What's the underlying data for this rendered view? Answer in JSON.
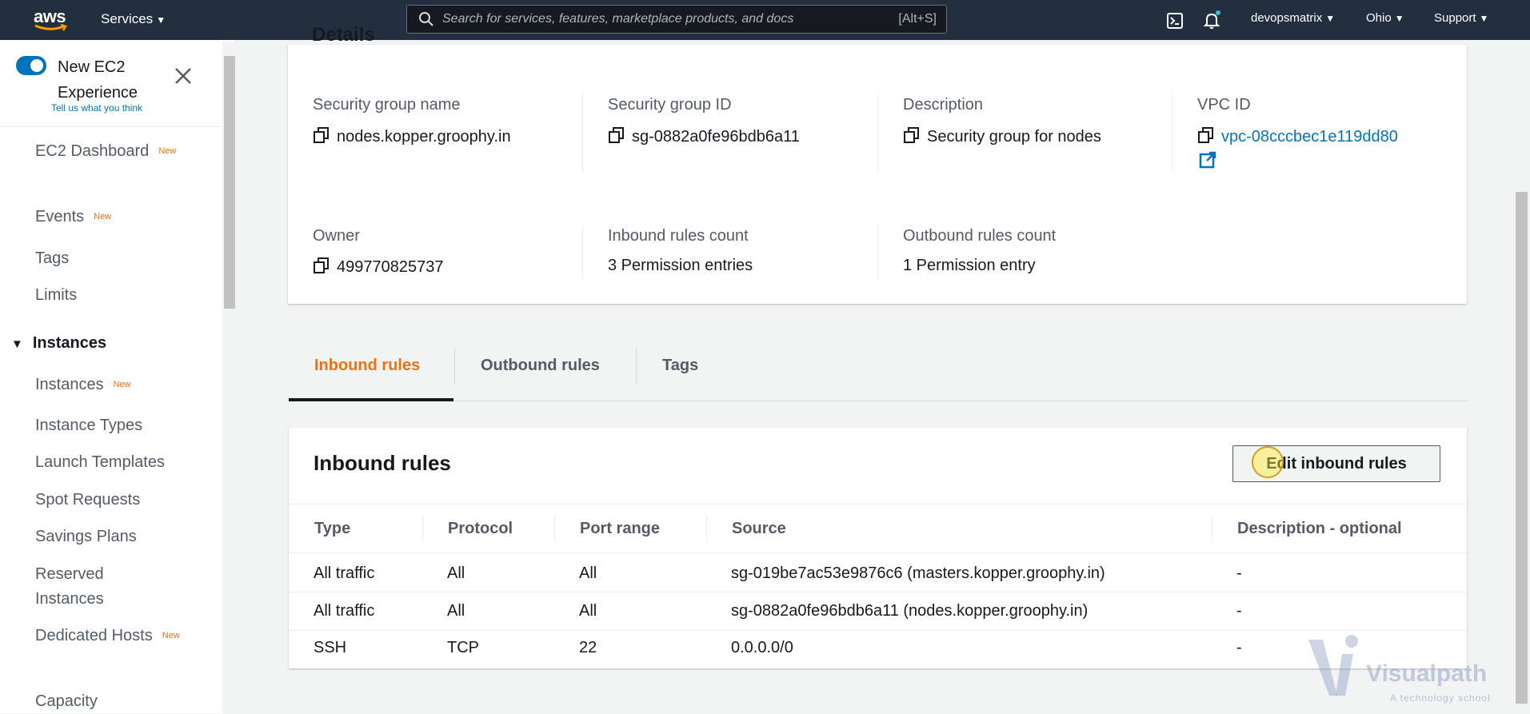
{
  "topnav": {
    "logo_text": "aws",
    "services_label": "Services",
    "search_placeholder": "Search for services, features, marketplace products, and docs",
    "search_shortcut": "[Alt+S]",
    "account_label": "devopsmatrix",
    "region_label": "Ohio",
    "support_label": "Support"
  },
  "sidebar": {
    "experience_title": "New EC2 Experience",
    "experience_feedback": "Tell us what you think",
    "new_badge": "New",
    "items": [
      {
        "label": "EC2 Dashboard",
        "new": true
      },
      {
        "label": "Events",
        "new": true
      },
      {
        "label": "Tags",
        "new": false
      },
      {
        "label": "Limits",
        "new": false
      }
    ],
    "section_title": "Instances",
    "section_items": [
      {
        "label": "Instances",
        "new": true
      },
      {
        "label": "Instance Types",
        "new": false
      },
      {
        "label": "Launch Templates",
        "new": false
      },
      {
        "label": "Spot Requests",
        "new": false
      },
      {
        "label": "Savings Plans",
        "new": false
      },
      {
        "label": "Reserved Instances",
        "new": false
      },
      {
        "label": "Dedicated Hosts",
        "new": true
      },
      {
        "label": "Capacity",
        "new": false
      }
    ]
  },
  "details": {
    "heading": "Details",
    "fields": {
      "sg_name_label": "Security group name",
      "sg_name_value": "nodes.kopper.groophy.in",
      "sg_id_label": "Security group ID",
      "sg_id_value": "sg-0882a0fe96bdb6a11",
      "description_label": "Description",
      "description_value": "Security group for nodes",
      "vpc_label": "VPC ID",
      "vpc_value": "vpc-08cccbec1e119dd80",
      "owner_label": "Owner",
      "owner_value": "499770825737",
      "inbound_count_label": "Inbound rules count",
      "inbound_count_value": "3 Permission entries",
      "outbound_count_label": "Outbound rules count",
      "outbound_count_value": "1 Permission entry"
    }
  },
  "tabs": [
    {
      "label": "Inbound rules",
      "active": true
    },
    {
      "label": "Outbound rules",
      "active": false
    },
    {
      "label": "Tags",
      "active": false
    }
  ],
  "inbound": {
    "title": "Inbound rules",
    "edit_button": "Edit inbound rules",
    "columns": [
      "Type",
      "Protocol",
      "Port range",
      "Source",
      "Description - optional"
    ],
    "rows": [
      [
        "All traffic",
        "All",
        "All",
        "sg-019be7ac53e9876c6 (masters.kopper.groophy.in)",
        "-"
      ],
      [
        "All traffic",
        "All",
        "All",
        "sg-0882a0fe96bdb6a11 (nodes.kopper.groophy.in)",
        "-"
      ],
      [
        "SSH",
        "TCP",
        "22",
        "0.0.0.0/0",
        "-"
      ]
    ]
  },
  "watermark": {
    "brand": "Visualpath",
    "tagline": "A technology school"
  },
  "colors": {
    "nav_bg": "#232f3e",
    "accent_orange": "#ec7211",
    "link_blue": "#0073bb"
  }
}
